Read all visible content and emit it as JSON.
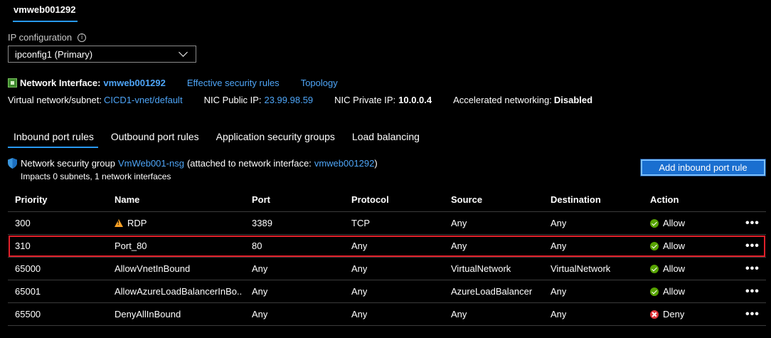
{
  "top_tab": "vmweb001292",
  "ip_configuration": {
    "label": "IP configuration",
    "selected": "ipconfig1 (Primary)"
  },
  "nic": {
    "label": "Network Interface:",
    "name": "vmweb001292",
    "effective_rules_link": "Effective security rules",
    "topology_link": "Topology",
    "subnet_label": "Virtual network/subnet:",
    "subnet_value": "CICD1-vnet/default",
    "public_ip_label": "NIC Public IP:",
    "public_ip_value": "23.99.98.59",
    "private_ip_label": "NIC Private IP:",
    "private_ip_value": "10.0.0.4",
    "accel_label": "Accelerated networking:",
    "accel_value": "Disabled"
  },
  "subtabs": [
    "Inbound port rules",
    "Outbound port rules",
    "Application security groups",
    "Load balancing"
  ],
  "nsg": {
    "prefix": "Network security group",
    "name": "VmWeb001-nsg",
    "attached_prefix": "(attached to network interface:",
    "attached_nic": "vmweb001292",
    "attached_suffix": ")",
    "impacts": "Impacts 0 subnets, 1 network interfaces"
  },
  "add_button": "Add inbound port rule",
  "table": {
    "headers": [
      "Priority",
      "Name",
      "Port",
      "Protocol",
      "Source",
      "Destination",
      "Action"
    ],
    "rows": [
      {
        "priority": "300",
        "name": "RDP",
        "port": "3389",
        "protocol": "TCP",
        "source": "Any",
        "destination": "Any",
        "action": "Allow",
        "more": "•••"
      },
      {
        "priority": "310",
        "name": "Port_80",
        "port": "80",
        "protocol": "Any",
        "source": "Any",
        "destination": "Any",
        "action": "Allow",
        "more": "•••"
      },
      {
        "priority": "65000",
        "name": "AllowVnetInBound",
        "port": "Any",
        "protocol": "Any",
        "source": "VirtualNetwork",
        "destination": "VirtualNetwork",
        "action": "Allow",
        "more": "•••"
      },
      {
        "priority": "65001",
        "name": "AllowAzureLoadBalancerInBo...",
        "port": "Any",
        "protocol": "Any",
        "source": "AzureLoadBalancer",
        "destination": "Any",
        "action": "Allow",
        "more": "•••"
      },
      {
        "priority": "65500",
        "name": "DenyAllInBound",
        "port": "Any",
        "protocol": "Any",
        "source": "Any",
        "destination": "Any",
        "action": "Deny",
        "more": "•••"
      }
    ]
  },
  "colors": {
    "accent": "#2899f5",
    "link": "#4ea5f7",
    "allow": "#57a300",
    "deny": "#e0353a",
    "highlight": "#e0202a",
    "warning": "#f7a024"
  }
}
